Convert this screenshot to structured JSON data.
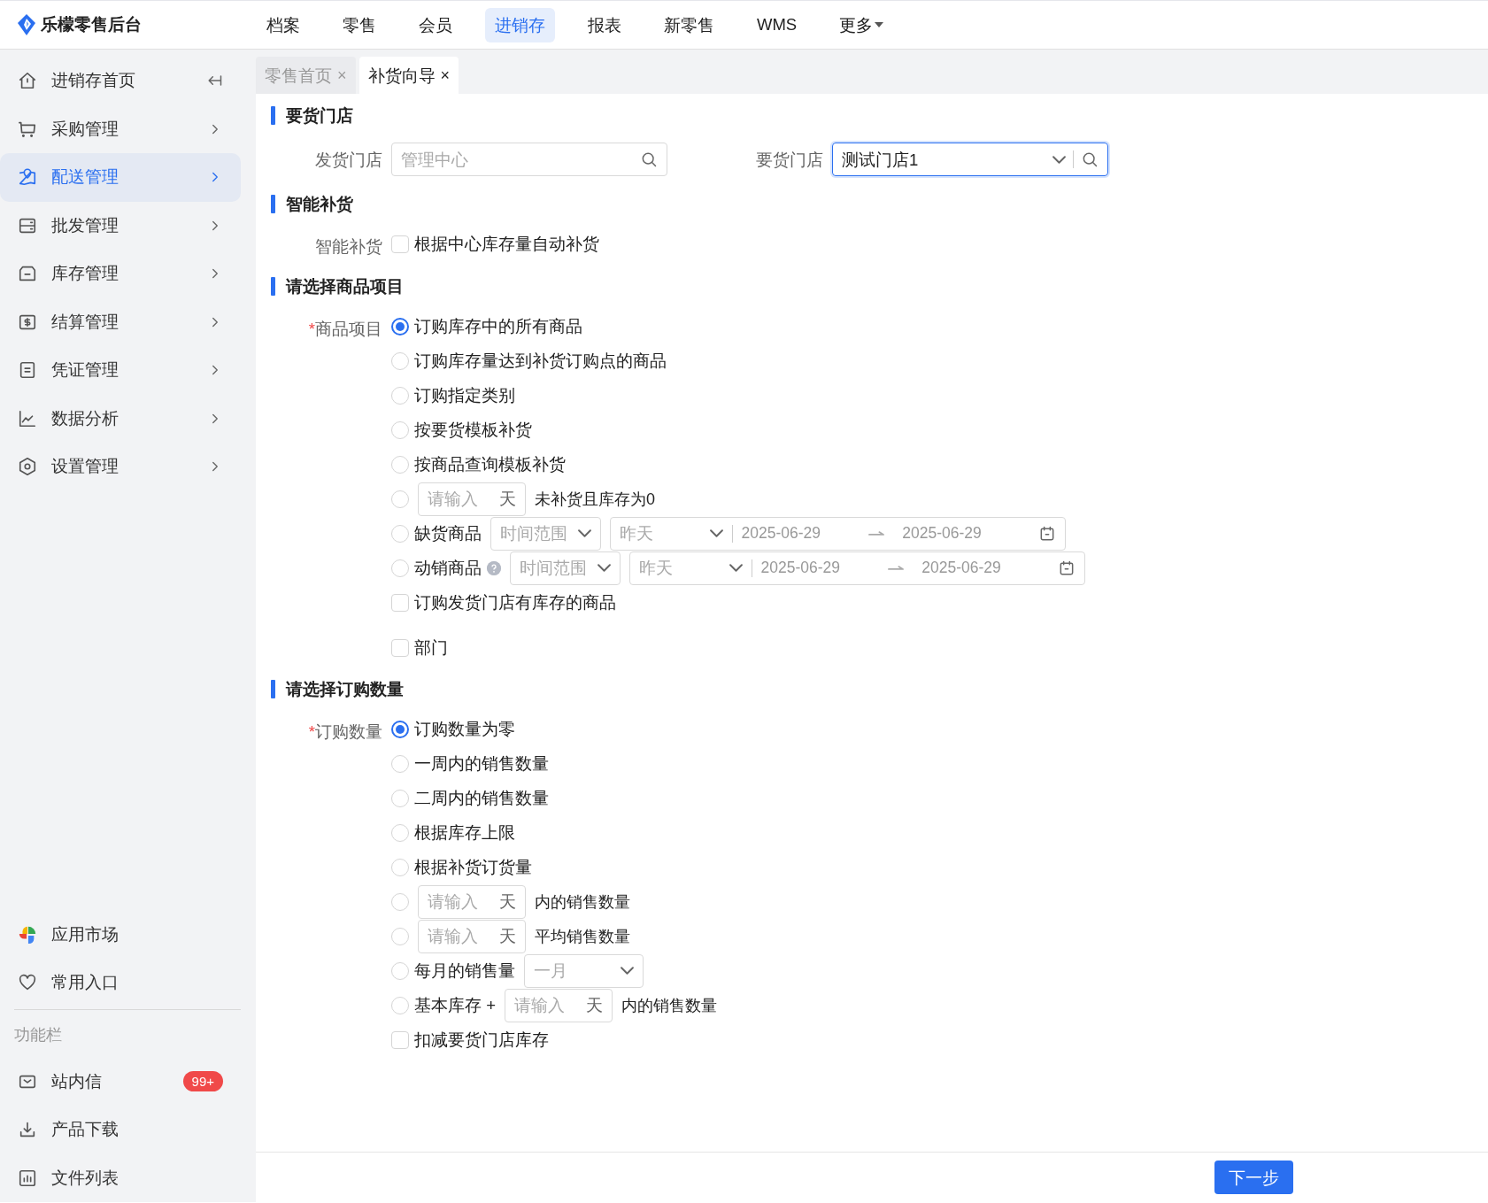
{
  "header": {
    "logo": "乐檬零售后台",
    "nav": [
      {
        "label": "档案",
        "kind": "link",
        "selected": false
      },
      {
        "label": "零售",
        "kind": "link",
        "selected": false
      },
      {
        "label": "会员",
        "kind": "link",
        "selected": false
      },
      {
        "label": "进销存",
        "kind": "link",
        "selected": true
      },
      {
        "label": "报表",
        "kind": "link",
        "selected": false
      },
      {
        "label": "新零售",
        "kind": "link",
        "selected": false
      },
      {
        "label": "WMS",
        "kind": "link",
        "selected": false
      },
      {
        "label": "更多",
        "kind": "dropdown",
        "selected": false
      }
    ]
  },
  "sidebar": {
    "items": [
      {
        "label": "进销存首页",
        "kind": "collapse",
        "selected": false
      },
      {
        "label": "采购管理",
        "kind": "submenu",
        "selected": false
      },
      {
        "label": "配送管理",
        "kind": "submenu",
        "selected": true
      },
      {
        "label": "批发管理",
        "kind": "submenu",
        "selected": false
      },
      {
        "label": "库存管理",
        "kind": "submenu",
        "selected": false
      },
      {
        "label": "结算管理",
        "kind": "submenu",
        "selected": false
      },
      {
        "label": "凭证管理",
        "kind": "submenu",
        "selected": false
      },
      {
        "label": "数据分析",
        "kind": "submenu",
        "selected": false
      },
      {
        "label": "设置管理",
        "kind": "submenu",
        "selected": false
      }
    ],
    "apps": [
      {
        "label": "应用市场"
      },
      {
        "label": "常用入口"
      }
    ],
    "section_label": "功能栏",
    "tools": [
      {
        "label": "站内信",
        "badge": "99+"
      },
      {
        "label": "产品下载"
      },
      {
        "label": "文件列表"
      }
    ]
  },
  "tabs": [
    {
      "label": "零售首页",
      "close": "×",
      "selected": false
    },
    {
      "label": "补货向导",
      "close": "×",
      "selected": true
    }
  ],
  "sections": [
    {
      "title": "要货门店",
      "kind": "fields",
      "fields": [
        {
          "label": "发货门店",
          "kind": "search",
          "placeholder": "管理中心",
          "focused": false
        },
        {
          "label": "要货门店",
          "kind": "select-search",
          "value": "测试门店1",
          "focused": true
        }
      ]
    },
    {
      "title": "智能补货",
      "kind": "options",
      "label": "智能补货",
      "options": [
        {
          "kind": "checkbox",
          "label": "根据中心库存量自动补货",
          "checked": false
        }
      ]
    },
    {
      "title": "请选择商品项目",
      "kind": "options",
      "label": "商品项目",
      "required_mark": "*",
      "options": [
        {
          "kind": "radio",
          "label": "订购库存中的所有商品",
          "selected": true
        },
        {
          "kind": "radio",
          "label": "订购库存量达到补货订购点的商品",
          "selected": false
        },
        {
          "kind": "radio",
          "label": "订购指定类别",
          "selected": false
        },
        {
          "kind": "radio",
          "label": "按要货模板补货",
          "selected": false
        },
        {
          "kind": "radio",
          "label": "按商品查询模板补货",
          "selected": false
        },
        {
          "kind": "radio-days",
          "placeholder": "请输入",
          "unit": "天",
          "text": "未补货且库存为0",
          "selected": false
        },
        {
          "kind": "radio-range",
          "label": "缺货商品",
          "range_select": "时间范围",
          "period": "昨天",
          "start": "2025-06-29",
          "end": "2025-06-29",
          "selected": false
        },
        {
          "kind": "radio-range",
          "label": "动销商品",
          "help": true,
          "range_select": "时间范围",
          "period": "昨天",
          "start": "2025-06-29",
          "end": "2025-06-29",
          "selected": false
        },
        {
          "kind": "checkbox",
          "label": "订购发货门店有库存的商品",
          "checked": false
        },
        {
          "kind": "checkbox",
          "label": "部门",
          "checked": false,
          "spaced": true
        }
      ]
    },
    {
      "title": "请选择订购数量",
      "kind": "options",
      "label": "订购数量",
      "required_mark": "*",
      "options": [
        {
          "kind": "radio",
          "label": "订购数量为零",
          "selected": true
        },
        {
          "kind": "radio",
          "label": "一周内的销售数量",
          "selected": false
        },
        {
          "kind": "radio",
          "label": "二周内的销售数量",
          "selected": false
        },
        {
          "kind": "radio",
          "label": "根据库存上限",
          "selected": false
        },
        {
          "kind": "radio",
          "label": "根据补货订货量",
          "selected": false
        },
        {
          "kind": "radio-days",
          "placeholder": "请输入",
          "unit": "天",
          "text": "内的销售数量",
          "selected": false
        },
        {
          "kind": "radio-days",
          "placeholder": "请输入",
          "unit": "天",
          "text": "平均销售数量",
          "selected": false
        },
        {
          "kind": "radio-select",
          "label": "每月的销售量",
          "select_value": "一月",
          "selected": false
        },
        {
          "kind": "radio-prefix-days",
          "label": "基本库存 +",
          "placeholder": "请输入",
          "unit": "天",
          "text": "内的销售数量",
          "selected": false
        },
        {
          "kind": "checkbox",
          "label": "扣减要货门店库存",
          "checked": false
        }
      ]
    }
  ],
  "footer": {
    "next_button": "下一步"
  }
}
